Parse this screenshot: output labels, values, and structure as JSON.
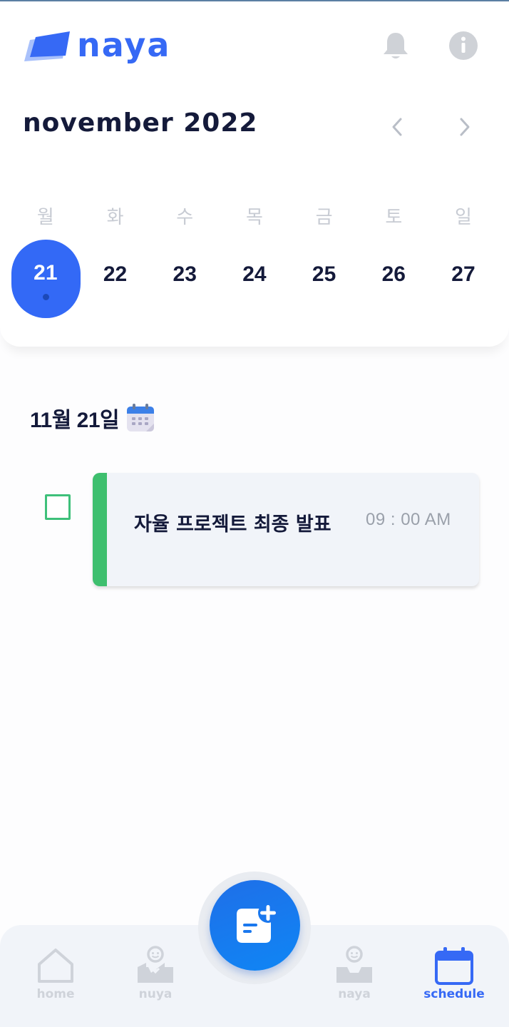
{
  "app": {
    "logo_text": "naya"
  },
  "header": {
    "month_title": "november 2022"
  },
  "calendar": {
    "weekdays": [
      "월",
      "화",
      "수",
      "목",
      "금",
      "토",
      "일"
    ],
    "days": [
      "21",
      "22",
      "23",
      "24",
      "25",
      "26",
      "27"
    ],
    "selected_day": "21"
  },
  "schedule": {
    "date_heading": "11월 21일",
    "tasks": [
      {
        "title": "자율 프로젝트 최종 발표",
        "time": "09 : 00 AM",
        "done": false,
        "color": "#3ebf6e"
      }
    ]
  },
  "nav": {
    "items": [
      {
        "label": "home",
        "icon": "home-icon",
        "active": false
      },
      {
        "label": "nuya",
        "icon": "nuya-inbox-icon",
        "active": false
      },
      {
        "label": "naya",
        "icon": "naya-inbox-icon",
        "active": false
      },
      {
        "label": "schedule",
        "icon": "calendar-icon",
        "active": true
      }
    ],
    "fab_icon": "add-note-icon"
  },
  "colors": {
    "accent": "#3369f6",
    "text_dark": "#141a3a",
    "task_green": "#3ebf6e",
    "inactive": "#cfd3da"
  }
}
